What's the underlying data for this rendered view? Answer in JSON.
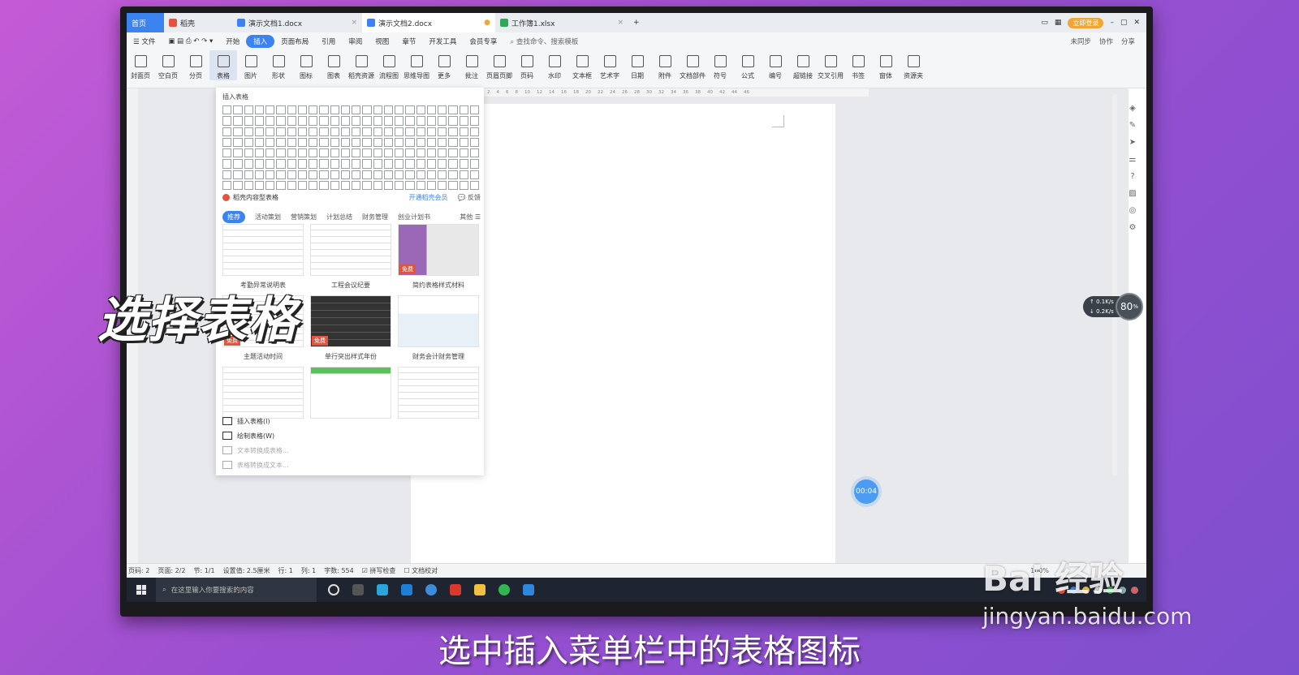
{
  "titlebar": {
    "tabs": [
      {
        "label": "首页",
        "type": "home"
      },
      {
        "label": "稻壳",
        "type": "docer"
      },
      {
        "label": "演示文档1.docx",
        "type": "doc"
      },
      {
        "label": "演示文档2.docx",
        "type": "doc-active"
      },
      {
        "label": "工作簿1.xlsx",
        "type": "xls"
      }
    ],
    "new_tab": "+",
    "vip_label": "立即登录"
  },
  "menubar": {
    "file": "☰ 文件",
    "items": [
      "开始",
      "插入",
      "页面布局",
      "引用",
      "审阅",
      "视图",
      "章节",
      "开发工具",
      "会员专享"
    ],
    "active": "插入",
    "search": "查找命令、搜索模板",
    "right": [
      "未同步",
      "协作",
      "分享"
    ]
  },
  "ribbon": [
    "封面页",
    "空白页",
    "分页",
    "表格",
    "图片",
    "形状",
    "图标",
    "图表",
    "稻壳资源",
    "流程图",
    "思维导图",
    "更多",
    "批注",
    "页眉页脚",
    "页码",
    "水印",
    "文本框",
    "艺术字",
    "日期",
    "附件",
    "文档部件",
    "符号",
    "公式",
    "编号",
    "超链接",
    "交叉引用",
    "书签",
    "窗体",
    "资源夹"
  ],
  "ruler_ticks": [
    "2",
    "4",
    "6",
    "8",
    "10",
    "12",
    "14",
    "16",
    "18",
    "20",
    "22",
    "24",
    "26",
    "28",
    "30",
    "32",
    "34",
    "36",
    "38",
    "40",
    "42",
    "44",
    "46"
  ],
  "dropdown": {
    "title": "插入表格",
    "template_heading": "稻壳内容型表格",
    "vip_link": "开通稻壳会员",
    "feedback": "反馈",
    "categories": [
      "推荐",
      "活动策划",
      "营销策划",
      "计划总结",
      "财务管理",
      "创业计划书"
    ],
    "active_category": "推荐",
    "more": "其他 ☰",
    "cards": [
      {
        "caption": "考勤异常说明表",
        "style": "",
        "badge": ""
      },
      {
        "caption": "工程会议纪要",
        "style": "",
        "badge": ""
      },
      {
        "caption": "简约表格样式材料",
        "style": "purple",
        "badge": "免费"
      },
      {
        "caption": "主题活动时间",
        "style": "",
        "badge": "免费"
      },
      {
        "caption": "单行突出样式年份",
        "style": "dark",
        "badge": "免费"
      },
      {
        "caption": "财务会计财务管理",
        "style": "resume",
        "badge": ""
      },
      {
        "caption": "",
        "style": "",
        "badge": ""
      },
      {
        "caption": "",
        "style": "green",
        "badge": ""
      },
      {
        "caption": "",
        "style": "",
        "badge": ""
      }
    ],
    "actions": [
      {
        "label": "插入表格(I)",
        "enabled": true
      },
      {
        "label": "绘制表格(W)",
        "enabled": true
      },
      {
        "label": "文本转换成表格...",
        "enabled": false
      },
      {
        "label": "表格转换成文本...",
        "enabled": false
      }
    ]
  },
  "statusbar": {
    "items": [
      "页码: 2",
      "页面: 2/2",
      "节: 1/1",
      "设置值: 2.5厘米",
      "行: 1",
      "列: 1",
      "字数: 554",
      "☑ 拼写检查",
      "☐ 文档校对"
    ],
    "zoom": "100%"
  },
  "netmeter": {
    "up": "0.1",
    "down": "0.2",
    "unit": "K/s",
    "percent": "80",
    "percent_unit": "%"
  },
  "timer": "00:04",
  "taskbar": {
    "search_placeholder": "在这里输入你要搜索的内容"
  },
  "overlay": {
    "title": "选择表格",
    "subtitle": "选中插入菜单栏中的表格图标",
    "watermark_brand": "Bai 经验",
    "watermark_url": "jingyan.baidu.com"
  },
  "colors": {
    "accent": "#3b83f0",
    "background": "#a855d6",
    "taskbar": "#1f2530"
  }
}
